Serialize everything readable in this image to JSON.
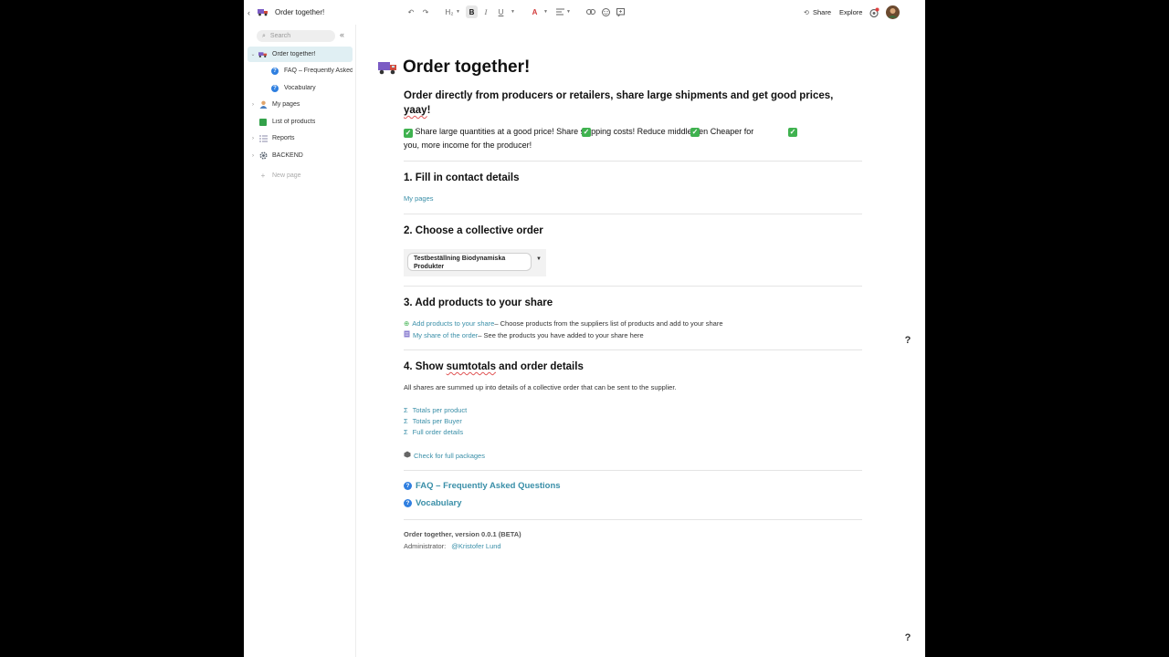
{
  "topbar": {
    "back_icon": "chevron-left-icon",
    "page_title": "Order together!",
    "heading_level": "H₂",
    "bold": "B",
    "italic": "I",
    "underline": "U",
    "font_color": "A",
    "share_label": "Share",
    "explore_label": "Explore"
  },
  "sidebar": {
    "search_placeholder": "Search",
    "items": [
      {
        "label": "Order together!",
        "icon": "truck-icon",
        "selected": true
      },
      {
        "label": "FAQ – Frequently Asked Questions",
        "icon": "question-icon"
      },
      {
        "label": "Vocabulary",
        "icon": "question-icon"
      },
      {
        "label": "My pages",
        "icon": "person-icon"
      },
      {
        "label": "List of products",
        "icon": "green-book-icon"
      },
      {
        "label": "Reports",
        "icon": "list-icon"
      },
      {
        "label": "BACKEND",
        "icon": "gear-icon"
      }
    ],
    "new_page": "New page"
  },
  "main": {
    "title": "Order together!",
    "lead_part1": "Order directly from producers or retailers, share large shipments and get good prices, ",
    "lead_squiggle": "yaay",
    "lead_end": "!",
    "benefits_line1": " Share large quantities at a good price!  Share shipping costs!  Reduce middlemen  Cheaper for",
    "benefits_line2": "you, more income for the producer!",
    "step1_heading": "1. Fill in contact details",
    "step1_link": "My pages",
    "step2_heading": "2. Choose a collective order",
    "step2_dropdown_value_line1": "Testbeställning Biodynamiska",
    "step2_dropdown_value_line2": "Produkter",
    "step3_heading": "3. Add products to your share",
    "step3_link1": "Add products to your share",
    "step3_text1": " – Choose products from the suppliers list of products and add to your share",
    "step3_link2": "My share of the order",
    "step3_text2": " – See the products you have added to your share here",
    "step4_heading_pre": "4. Show ",
    "step4_heading_squiggle": "sumtotals",
    "step4_heading_post": " and order details",
    "step4_desc": "All shares are summed up into details of a collective order that can be sent to the supplier.",
    "sigma": "Σ",
    "step4_links": [
      "Totals per product",
      "Totals per Buyer",
      "Full order details"
    ],
    "packages_link": "Check for full packages",
    "faq_link": "FAQ – Frequently Asked Questions",
    "vocab_link": "Vocabulary",
    "version": "Order together, version 0.0.1 (BETA)",
    "admin_label": "Administrator:",
    "admin_name": "Kristofer Lund"
  },
  "help_label": "?",
  "colors": {
    "accent": "#3a8fa8",
    "check_green": "#3fb24f",
    "question_blue": "#2f7fe0"
  }
}
